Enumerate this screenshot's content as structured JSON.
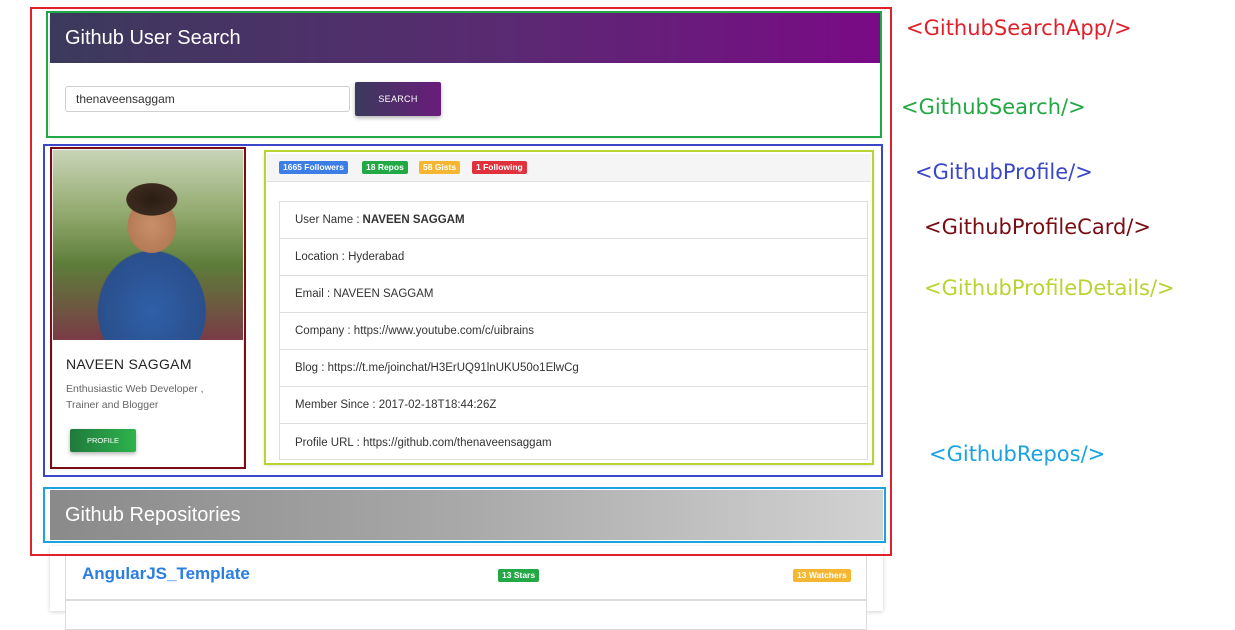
{
  "annotations": {
    "app": "<GithubSearchApp/>",
    "search": "<GithubSearch/>",
    "profile": "<GithubProfile/>",
    "profile_card": "<GithubProfileCard/>",
    "profile_details": "<GithubProfileDetails/>",
    "repos": "<GithubRepos/>"
  },
  "colors": {
    "app": "#e0212b",
    "search": "#22a845",
    "profile": "#3a47c8",
    "profile_card": "#7a0c14",
    "profile_details": "#b8d432",
    "repos": "#1aa3e0"
  },
  "search": {
    "title": "Github User Search",
    "input_value": "thenaveensaggam",
    "button_label": "SEARCH"
  },
  "profile_card": {
    "name": "NAVEEN SAGGAM",
    "bio": "Enthusiastic Web Developer , Trainer and Blogger",
    "button_label": "PROFILE"
  },
  "badges": [
    {
      "text": "1665 Followers",
      "color": "#3c7de6"
    },
    {
      "text": "18 Repos",
      "color": "#22a845"
    },
    {
      "text": "58 Gists",
      "color": "#f5b731"
    },
    {
      "text": "1 Following",
      "color": "#e0313d"
    }
  ],
  "details": [
    {
      "label": "User Name :",
      "value": "NAVEEN SAGGAM"
    },
    {
      "label": "Location : Hyderabad",
      "value": ""
    },
    {
      "label": "Email : NAVEEN SAGGAM",
      "value": ""
    },
    {
      "label": "Company : https://www.youtube.com/c/uibrains",
      "value": ""
    },
    {
      "label": "Blog : https://t.me/joinchat/H3ErUQ91lnUKU50o1ElwCg",
      "value": ""
    },
    {
      "label": "Member Since : 2017-02-18T18:44:26Z",
      "value": ""
    },
    {
      "label": "Profile URL : https://github.com/thenaveensaggam",
      "value": ""
    }
  ],
  "repos": {
    "title": "Github Repositories",
    "items": [
      {
        "name": "AngularJS_Template",
        "stars": "13 Stars",
        "watchers": "13 Watchers"
      }
    ]
  }
}
